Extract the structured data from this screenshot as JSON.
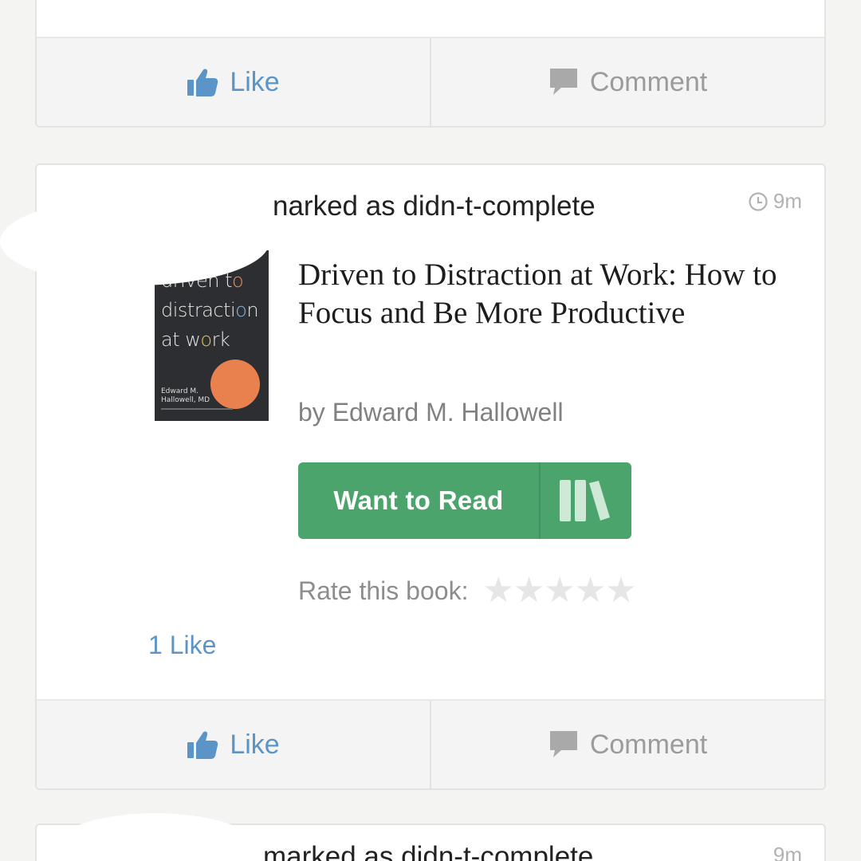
{
  "feed": {
    "previous_card": {
      "like_label": "Like",
      "comment_label": "Comment"
    },
    "card": {
      "activity": "narked as didn-t-complete",
      "time": "9m",
      "cover": {
        "title_lines": [
          "driven to",
          "distraction",
          "at work"
        ],
        "author_lines": [
          "Edward M.",
          "Hallowell, MD"
        ]
      },
      "book_title": "Driven to Distraction at Work: How to Focus and Be More Productive",
      "book_author": "by Edward M. Hallowell",
      "want_to_read_label": "Want to Read",
      "rate_label": "Rate this book:",
      "rating_max": 5,
      "likes_count": "1 Like",
      "like_label": "Like",
      "comment_label": "Comment"
    },
    "next_card": {
      "activity": "marked as didn-t-complete",
      "time": "9m"
    }
  },
  "colors": {
    "accent_blue": "#5b94c7",
    "want_to_read_green": "#4aa46c",
    "cover_orange": "#e9814f",
    "cover_background": "#2d2e31"
  },
  "icons": {
    "like": "thumbs-up-icon",
    "comment": "speech-bubble-icon",
    "time": "clock-icon",
    "shelf": "bookshelf-icon",
    "star": "star-icon"
  }
}
